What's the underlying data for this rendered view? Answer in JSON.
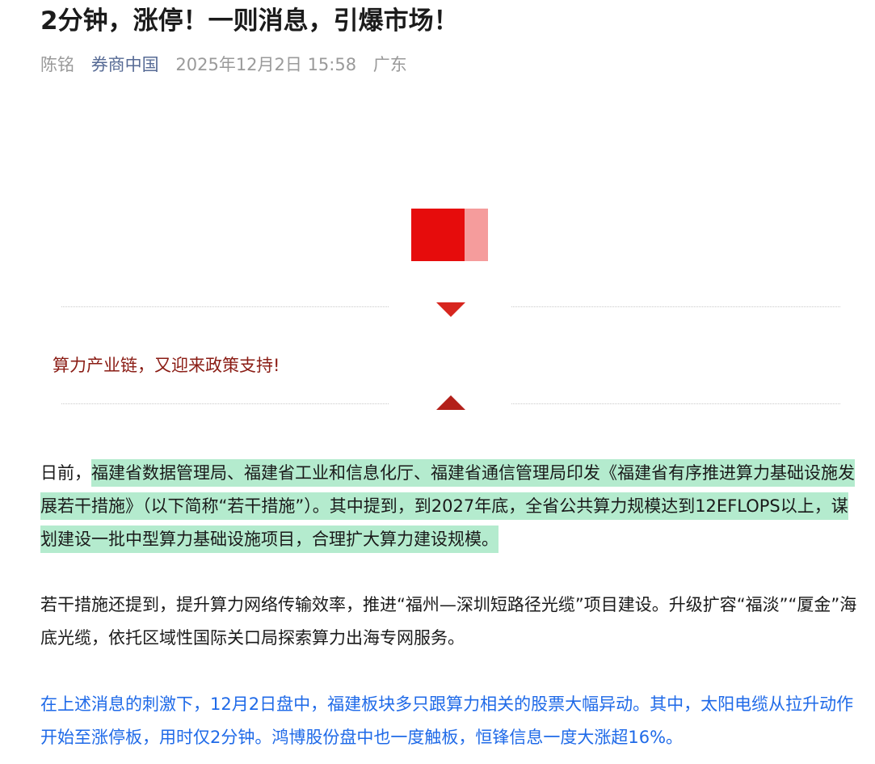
{
  "article": {
    "title": "2分钟，涨停！一则消息，引爆市场！",
    "author": "陈铭",
    "source": "券商中国",
    "datetime": "2025年12月2日 15:58",
    "location": "广东"
  },
  "section": {
    "subheading": "算力产业链，又迎来政策支持!"
  },
  "paragraphs": {
    "p1_prefix": "日前，",
    "p1_highlight": "福建省数据管理局、福建省工业和信息化厅、福建省通信管理局印发《福建省有序推进算力基础设施发展若干措施》（以下简称“若干措施”）。其中提到，到2027年底，全省公共算力规模达到12EFLOPS以上，谋划建设一批中型算力基础设施项目，合理扩大算力建设规模。",
    "p2": "若干措施还提到，提升算力网络传输效率，推进“福州—深圳短路径光缆”项目建设。升级扩容“福淡”“厦金”海底光缆，依托区域性国际关口局探索算力出海专网服务。",
    "p3": "在上述消息的刺激下，12月2日盘中，福建板块多只跟算力相关的股票大幅异动。其中，太阳电缆从拉升动作开始至涨停板，用时仅2分钟。鸿博股份盘中也一度触板，恒锋信息一度大涨超16%。"
  },
  "colors": {
    "highlight": "#b4ebce",
    "link_text": "#1f6ae8",
    "logo_red": "#e60c0c",
    "logo_pink": "#f59c9c",
    "subheading": "#8a1c14"
  }
}
